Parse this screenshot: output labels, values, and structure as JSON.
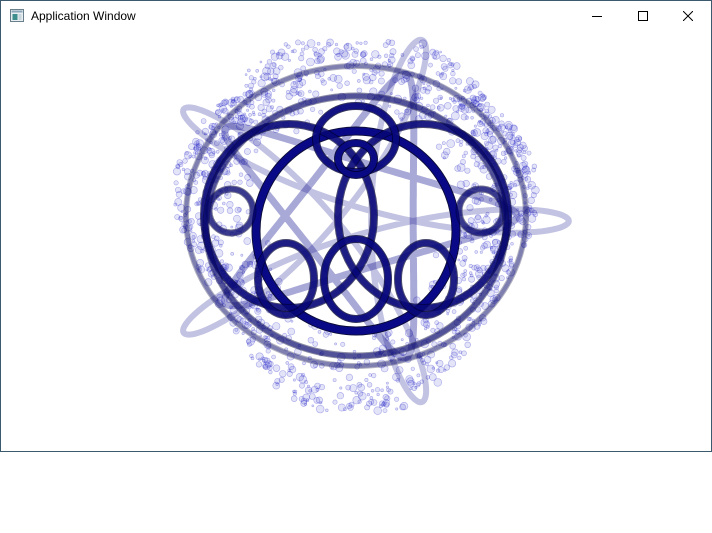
{
  "window": {
    "title": "Application Window",
    "controls": {
      "minimize_icon": "minimize-icon",
      "maximize_icon": "maximize-icon",
      "close_icon": "close-icon"
    }
  },
  "canvas": {
    "content": "spirograph-knot-pattern",
    "point_color": "#1f1fc8",
    "ring_color": "#0a0a8c",
    "ring_outline": "#000033"
  }
}
